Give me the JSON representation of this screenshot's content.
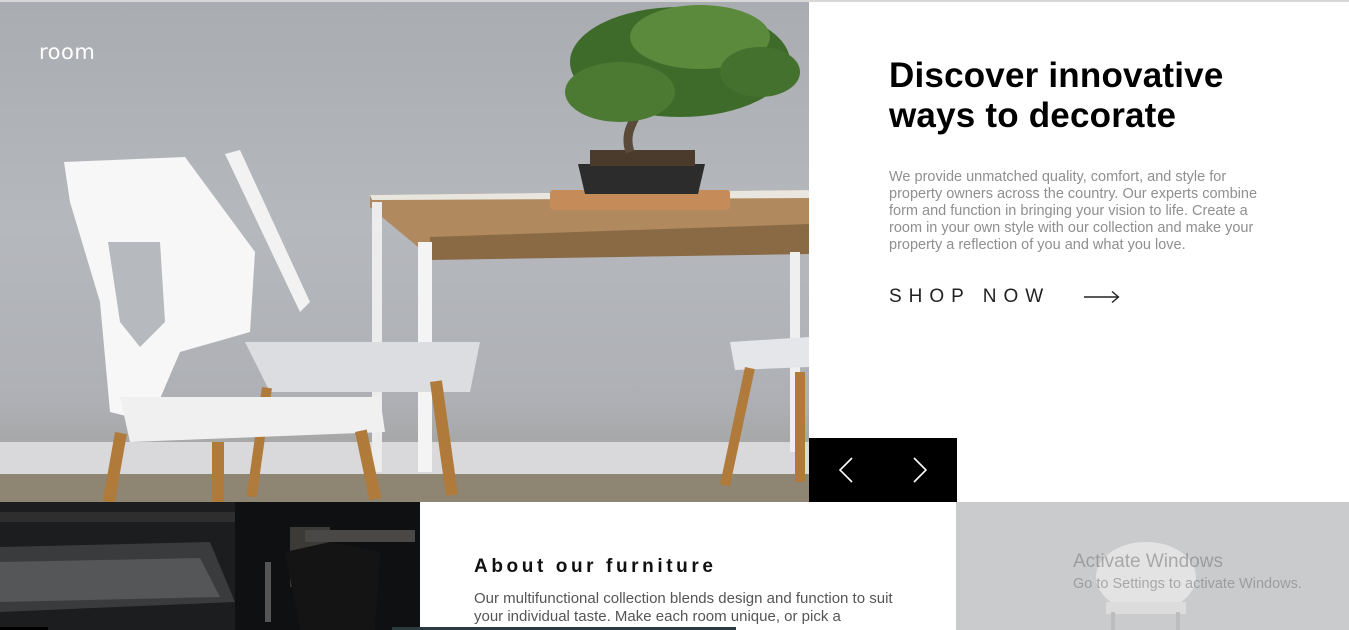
{
  "header": {
    "logo": "room"
  },
  "hero": {
    "title_line1": "Discover innovative",
    "title_line2": "ways to decorate",
    "description": "We provide unmatched quality, comfort, and style for property owners across the country. Our experts combine form and function in bringing your vision to life. Create a room in your own style with our collection and make your property a reflection of you and what you love.",
    "cta_label": "SHOP NOW",
    "cta_icon": "arrow-right-icon"
  },
  "slider": {
    "prev_icon": "chevron-left-icon",
    "next_icon": "chevron-right-icon"
  },
  "about": {
    "title": "About our furniture",
    "text": "Our multifunctional collection blends design and function to suit your individual taste. Make each room unique, or pick a"
  },
  "watermark": {
    "line1": "Activate Windows",
    "line2": "Go to Settings to activate Windows."
  },
  "colors": {
    "accent": "#000000",
    "text_muted": "#8f8f8f",
    "background": "#ffffff"
  }
}
